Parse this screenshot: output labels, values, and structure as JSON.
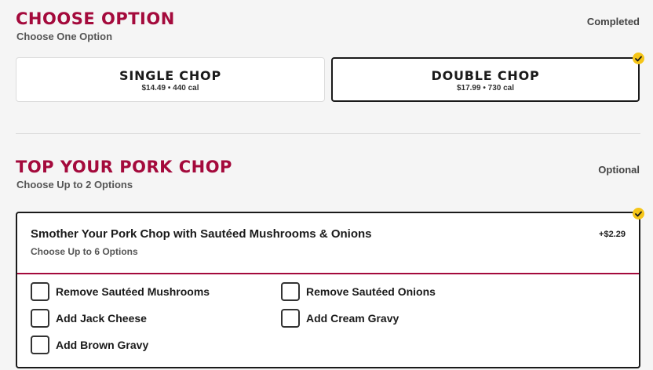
{
  "choose_option": {
    "title": "CHOOSE OPTION",
    "subtitle": "Choose One Option",
    "status": "Completed",
    "options": [
      {
        "name": "SINGLE CHOP",
        "price": "$14.49",
        "separator": "•",
        "calories": "440 cal",
        "selected": false
      },
      {
        "name": "DOUBLE CHOP",
        "price": "$17.99",
        "separator": "•",
        "calories": "730 cal",
        "selected": true
      }
    ]
  },
  "top_pork_chop": {
    "title": "TOP YOUR PORK CHOP",
    "subtitle": "Choose Up to 2 Options",
    "status": "Optional",
    "modifier": {
      "title": "Smother Your Pork Chop with Sautéed Mushrooms & Onions",
      "subtitle": "Choose Up to 6 Options",
      "price": "+$2.29",
      "selected": true,
      "choices": [
        {
          "label": "Remove Sautéed Mushrooms",
          "checked": false
        },
        {
          "label": "Remove Sautéed Onions",
          "checked": false
        },
        {
          "label": "Add Jack Cheese",
          "checked": false
        },
        {
          "label": "Add Cream Gravy",
          "checked": false
        },
        {
          "label": "Add Brown Gravy",
          "checked": false
        }
      ]
    }
  },
  "colors": {
    "accent": "#a40a3c",
    "check_badge": "#f5c518",
    "background": "#f5f5f5"
  },
  "icons": {
    "selected_badge": "checkmark-icon"
  }
}
